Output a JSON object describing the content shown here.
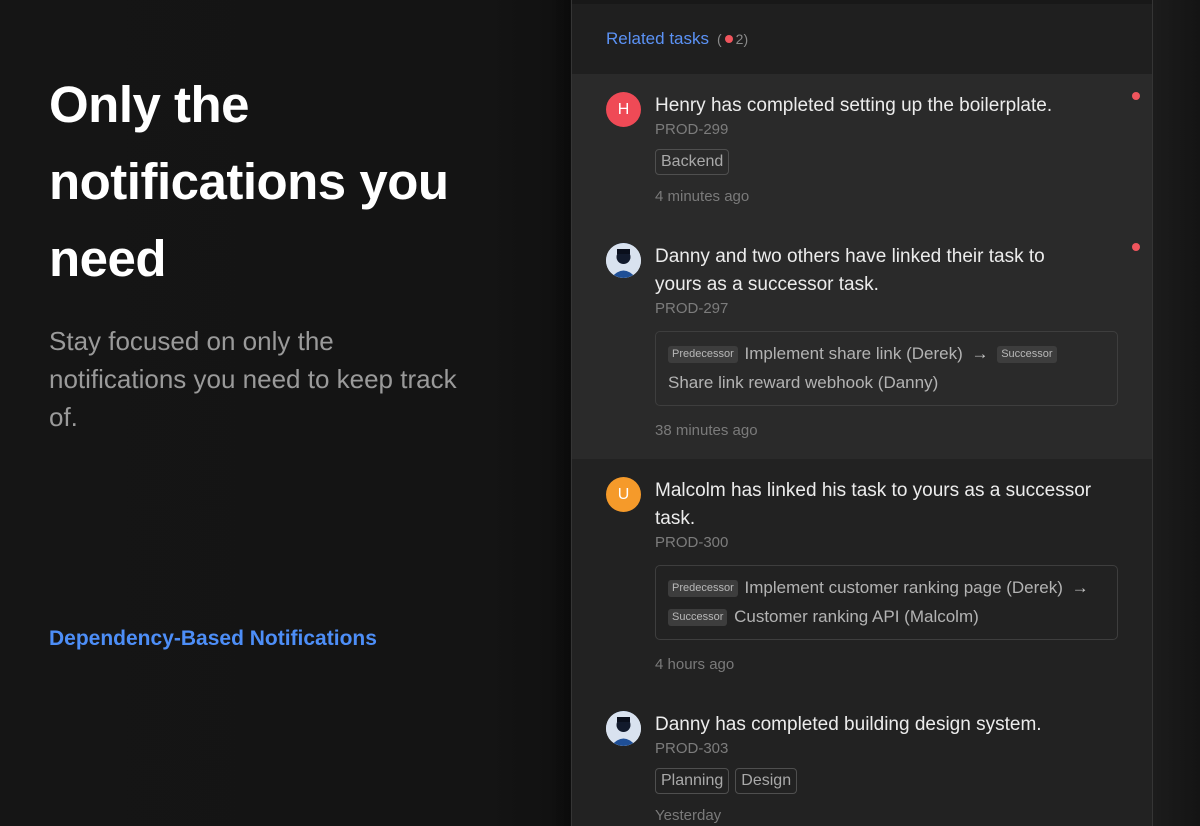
{
  "hero": {
    "title": "Only the notifications you need",
    "subtitle": "Stay focused on only the notifications you need to keep track of.",
    "feature_link": "Dependency-Based Notifications"
  },
  "panel": {
    "header_label": "Related tasks",
    "header_open": "(",
    "header_count": "2)",
    "notifications": [
      {
        "avatar_initial": "H",
        "avatar_color": "#ef4a56",
        "text": "Henry has completed setting up the boilerplate.",
        "id": "PROD-299",
        "tags": [
          "Backend"
        ],
        "time": "4 minutes ago",
        "unread": true
      },
      {
        "avatar_initial": "",
        "avatar_icon": "user-photo-avatar",
        "text": "Danny and two others have linked their task to yours as a successor task.",
        "id": "PROD-297",
        "link": {
          "predecessor_chip": "Predecessor",
          "predecessor": "Implement share link (Derek)",
          "arrow": "→",
          "successor_chip": "Successor",
          "successor": "Share link reward webhook (Danny)"
        },
        "time": "38 minutes ago",
        "unread": true
      },
      {
        "avatar_initial": "U",
        "avatar_color": "#f59a2a",
        "text": "Malcolm has linked his task to yours as a successor task.",
        "id": "PROD-300",
        "link": {
          "predecessor_chip": "Predecessor",
          "predecessor": "Implement customer ranking page (Derek)",
          "arrow": "→",
          "successor_chip": "Successor",
          "successor": "Customer ranking API (Malcolm)"
        },
        "time": "4 hours ago",
        "unread": false
      },
      {
        "avatar_initial": "",
        "avatar_icon": "user-photo-avatar",
        "text": "Danny has completed building design system.",
        "id": "PROD-303",
        "tags": [
          "Planning",
          "Design"
        ],
        "time": "Yesterday",
        "unread": false
      }
    ]
  },
  "colors": {
    "accent": "#4d8ef7",
    "unread_dot": "#f0555d",
    "background": "#141414",
    "panel": "#222222"
  }
}
